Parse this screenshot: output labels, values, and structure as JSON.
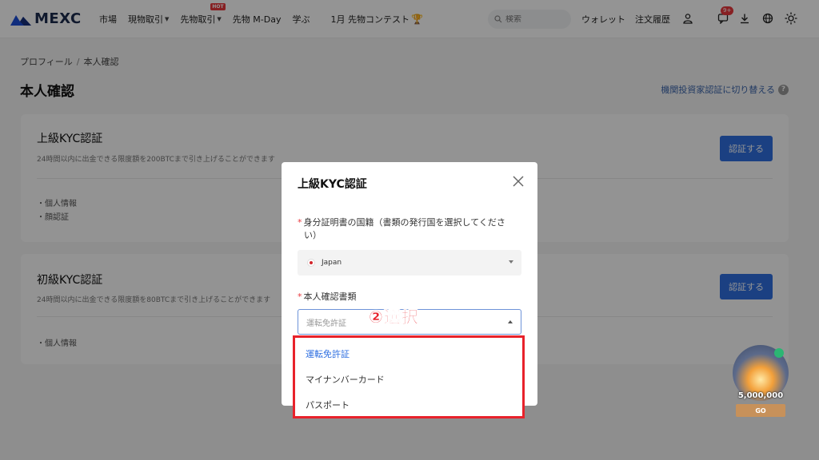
{
  "header": {
    "logo_text": "MEXC",
    "nav": [
      {
        "label": "市場",
        "dropdown": false,
        "hot": false
      },
      {
        "label": "現物取引",
        "dropdown": true,
        "hot": false
      },
      {
        "label": "先物取引",
        "dropdown": true,
        "hot": true
      },
      {
        "label": "先物 M-Day",
        "dropdown": false,
        "hot": false
      },
      {
        "label": "学ぶ",
        "dropdown": false,
        "hot": false
      },
      {
        "label": "1月 先物コンテスト",
        "dropdown": false,
        "hot": false
      }
    ],
    "hot_badge": "HOT",
    "search_placeholder": "検索",
    "wallet_label": "ウォレット",
    "orders_label": "注文履歴",
    "notification_count": "9+",
    "icons": [
      "search-icon",
      "user-icon",
      "message-icon",
      "download-icon",
      "globe-icon",
      "sun-icon",
      "trophy-icon"
    ]
  },
  "page": {
    "breadcrumb": [
      "プロフィール",
      "本人確認"
    ],
    "breadcrumb_sep": "/",
    "title": "本人確認",
    "switch_link": "機関投資家認証に切り替える",
    "help_icon_text": "?"
  },
  "cards": {
    "advanced": {
      "title": "上級KYC認証",
      "desc": "24時間以内に出金できる限度額を200BTCまで引き上げることができます",
      "items": [
        "・個人情報",
        "・顔認証"
      ],
      "button": "認証する"
    },
    "basic": {
      "title": "初級KYC認証",
      "desc": "24時間以内に出金できる限度額を80BTCまで引き上げることができます",
      "items": [
        "・個人情報"
      ],
      "button": "認証する"
    }
  },
  "modal": {
    "title": "上級KYC認証",
    "required_mark": "*",
    "country_label_1": "身分証明書の国籍（書類の発行国を選択してくださ",
    "country_label_2": "い）",
    "country_value": "Japan",
    "doc_label": "本人確認書類",
    "doc_value": "運転免許証",
    "options": [
      {
        "label": "運転免許証",
        "selected": true
      },
      {
        "label": "マイナンバーカード",
        "selected": false
      },
      {
        "label": "パスポート",
        "selected": false
      }
    ]
  },
  "annotation": "②選択",
  "promo": {
    "amount": "5,000,000",
    "button": "GO"
  },
  "colors": {
    "brand": "#1d2b4f",
    "primary": "#2f6fe0",
    "annotation": "#e8222b",
    "link": "#3a64ab"
  }
}
